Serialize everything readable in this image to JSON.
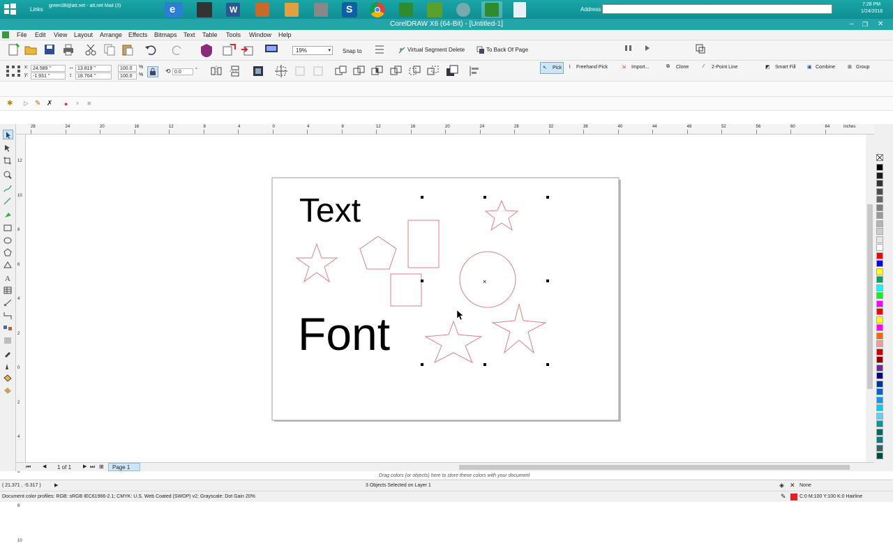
{
  "taskbar": {
    "links_label": "Links",
    "mail_label": "green38@att.net - att.net Mail (3)",
    "address_label": "Address",
    "clock_time": "7:28 PM",
    "clock_date": "1/24/2018",
    "pinned_apps": [
      "internet-explorer",
      "media-app",
      "word",
      "paint-app",
      "pen-app",
      "print-app",
      "skype",
      "chrome",
      "coreldraw",
      "coreldraw-leaf",
      "connect-app",
      "coreldraw-active",
      "document-app"
    ]
  },
  "window": {
    "title": "CorelDRAW X6 (64-Bit) - [Untitled-1]"
  },
  "menu": [
    "File",
    "Edit",
    "View",
    "Layout",
    "Arrange",
    "Effects",
    "Bitmaps",
    "Text",
    "Table",
    "Tools",
    "Window",
    "Help"
  ],
  "standard_toolbar": {
    "zoom": "19%",
    "snap_to": "Snap to",
    "virtual_segment_delete": "Virtual Segment Delete",
    "to_back_of_page": "To Back Of Page"
  },
  "property_bar": {
    "x": "24.589 \"",
    "y": "-1.931 \"",
    "width": "13.819 \"",
    "height": "18.704 \"",
    "scale_x": "100.0",
    "scale_y": "100.0",
    "percent": "%",
    "angle": "0.0",
    "degree": "°"
  },
  "command_bar": [
    "Pick",
    "Freehand Pick",
    "Import...",
    "Clone",
    "2-Point Line",
    "Smart Fill",
    "Combine",
    "Group"
  ],
  "ruler": {
    "h_ticks": [
      "28",
      "24",
      "20",
      "16",
      "12",
      "8",
      "4",
      "0",
      "4",
      "8",
      "12",
      "16",
      "20",
      "24",
      "28",
      "32",
      "36",
      "40",
      "44",
      "48",
      "52",
      "56",
      "60",
      "64"
    ],
    "h_unit": "inches",
    "v_ticks": [
      "12",
      "10",
      "8",
      "6",
      "4",
      "2",
      "0",
      "2",
      "4",
      "6",
      "8",
      "10"
    ]
  },
  "document": {
    "text_1": "Text",
    "text_2": "Font",
    "shape_color": "#d9828a"
  },
  "page_nav": {
    "page_count": "1 of 1",
    "page_tab": "Page 1"
  },
  "status": {
    "palette_hint": "Drag colors (or objects) here to store these colors with your document",
    "cursor_pos": "( 21.371 , -5.317 )",
    "selection": "3 Objects Selected on Layer 1",
    "fill_label": "None",
    "outline_label": "C:0 M:100 Y:100 K:0  Hairline",
    "color_profiles": "Document color profiles: RGB: sRGB IEC61966-2.1; CMYK: U.S. Web Coated (SWOP) v2; Grayscale: Dot Gain 20%"
  },
  "palette_colors": [
    "#000000",
    "#1a1a1a",
    "#333333",
    "#4d4d4d",
    "#666666",
    "#808080",
    "#999999",
    "#b3b3b3",
    "#cccccc",
    "#e6e6e6",
    "#ffffff",
    "#ff0000",
    "#0000ff",
    "#ffff00",
    "#00a651",
    "#00ffff",
    "#00ff00",
    "#ff00ff",
    "#ff0000",
    "#ffff00",
    "#ff00ff",
    "#ff6600",
    "#ff9999",
    "#cc0000",
    "#990000",
    "#6b2d8f",
    "#000080",
    "#003399",
    "#0066cc",
    "#0099ff",
    "#00ccff",
    "#66ccff",
    "#009999",
    "#006666",
    "#008080",
    "#336666",
    "#004d40"
  ],
  "colors": {
    "taskbar": "#1aa6a6",
    "titlebar": "#23a5a9",
    "accent_selected": "#cde6f7"
  }
}
